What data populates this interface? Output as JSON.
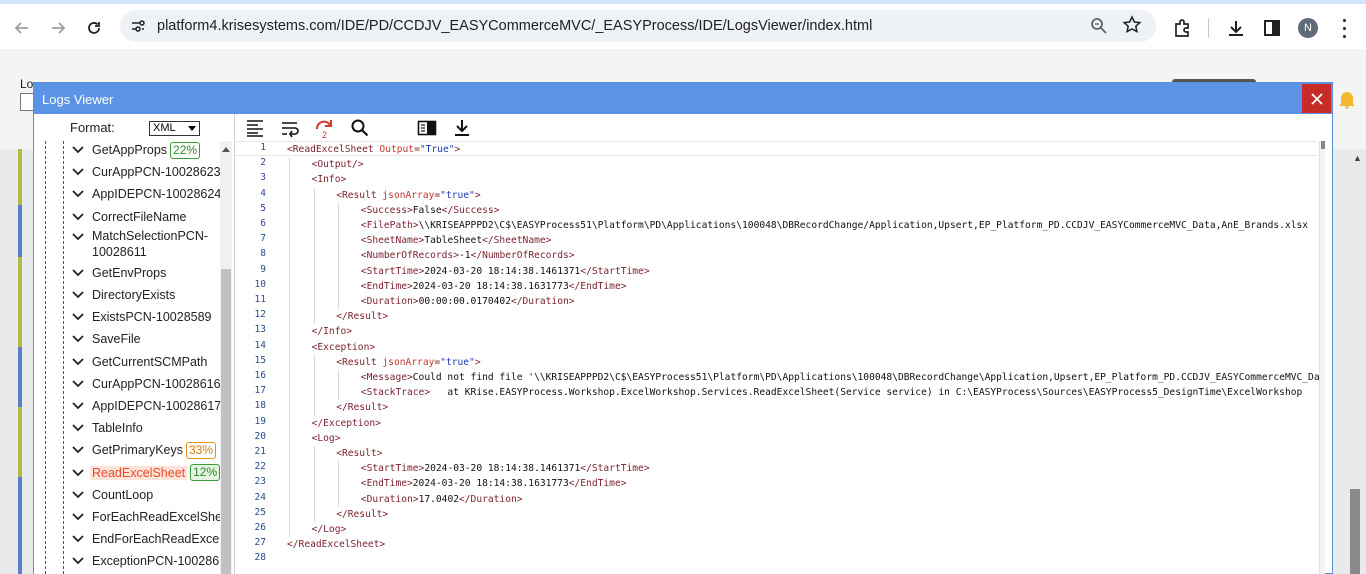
{
  "browser": {
    "url": "platform4.krisesystems.com/IDE/PD/CCDJV_EASYCommerceMVC/_EASYProcess/IDE/LogsViewer/index.html",
    "profile_initial": "N",
    "icons": [
      "back-icon",
      "forward-icon",
      "reload-icon",
      "site-settings-icon",
      "zoom-icon",
      "bookmark-star-icon",
      "extensions-icon",
      "download-icon",
      "side-panel-icon",
      "menu-icon"
    ]
  },
  "background": {
    "label_fragment": "Lo"
  },
  "modal": {
    "title": "Logs Viewer",
    "format_label": "Format:",
    "format_value": "XML"
  },
  "tree": {
    "items": [
      {
        "label": "GetAppProps",
        "badge": "22%",
        "badge_color": "green"
      },
      {
        "label": "CurAppPCN-10028623",
        "badge": ""
      },
      {
        "label": "AppIDEPCN-10028624",
        "badge": ""
      },
      {
        "label": "CorrectFileName",
        "badge": ""
      },
      {
        "label": "MatchSelectionPCN-10028611",
        "badge": ""
      },
      {
        "label": "GetEnvProps",
        "badge": ""
      },
      {
        "label": "DirectoryExists",
        "badge": ""
      },
      {
        "label": "ExistsPCN-10028589",
        "badge": ""
      },
      {
        "label": "SaveFile",
        "badge": ""
      },
      {
        "label": "GetCurrentSCMPath",
        "badge": ""
      },
      {
        "label": "CurAppPCN-10028616",
        "badge": ""
      },
      {
        "label": "AppIDEPCN-10028617",
        "badge": ""
      },
      {
        "label": "TableInfo",
        "badge": ""
      },
      {
        "label": "GetPrimaryKeys",
        "badge": "33%",
        "badge_color": "orange"
      },
      {
        "label": "ReadExcelSheet",
        "badge": "12%",
        "badge_color": "green",
        "selected": true
      },
      {
        "label": "CountLoop",
        "badge": ""
      },
      {
        "label": "ForEachReadExcelSheet",
        "badge": ""
      },
      {
        "label": "EndForEachReadExcelSheet",
        "badge": ""
      },
      {
        "label": "ExceptionPCN-10028610",
        "badge": ""
      }
    ]
  },
  "toolbar": {
    "tools": [
      "format-icon",
      "wrap-icon",
      "redo-icon",
      "search-icon",
      "panel-toggle-icon",
      "download-icon"
    ],
    "redo_count": "2"
  },
  "editor": {
    "lines": [
      {
        "n": "1",
        "indent": 0,
        "parts": [
          [
            "tag",
            "<ReadExcelSheet "
          ],
          [
            "attr",
            "Output"
          ],
          [
            "tag",
            "="
          ],
          [
            "val",
            "\"True\""
          ],
          [
            "tag",
            ">"
          ]
        ]
      },
      {
        "n": "2",
        "indent": 1,
        "parts": [
          [
            "tag",
            "<Output/>"
          ]
        ]
      },
      {
        "n": "3",
        "indent": 1,
        "parts": [
          [
            "tag",
            "<Info>"
          ]
        ]
      },
      {
        "n": "4",
        "indent": 2,
        "parts": [
          [
            "tag",
            "<Result "
          ],
          [
            "attr",
            "jsonArray"
          ],
          [
            "tag",
            "="
          ],
          [
            "val",
            "\"true\""
          ],
          [
            "tag",
            ">"
          ]
        ]
      },
      {
        "n": "5",
        "indent": 3,
        "parts": [
          [
            "tag",
            "<Success>"
          ],
          [
            "txt",
            "False"
          ],
          [
            "tag",
            "</Success>"
          ]
        ]
      },
      {
        "n": "6",
        "indent": 3,
        "parts": [
          [
            "tag",
            "<FilePath>"
          ],
          [
            "txt",
            "\\\\KRISEAPPPD2\\C$\\EASYProcess51\\Platform\\PD\\Applications\\100048\\DBRecordChange/Application,Upsert,EP_Platform_PD.CCDJV_EASYCommerceMVC_Data,AnE_Brands.xlsx"
          ]
        ]
      },
      {
        "n": "7",
        "indent": 3,
        "parts": [
          [
            "tag",
            "<SheetName>"
          ],
          [
            "txt",
            "TableSheet"
          ],
          [
            "tag",
            "</SheetName>"
          ]
        ]
      },
      {
        "n": "8",
        "indent": 3,
        "parts": [
          [
            "tag",
            "<NumberOfRecords>"
          ],
          [
            "txt",
            "-1"
          ],
          [
            "tag",
            "</NumberOfRecords>"
          ]
        ]
      },
      {
        "n": "9",
        "indent": 3,
        "parts": [
          [
            "tag",
            "<StartTime>"
          ],
          [
            "txt",
            "2024-03-20 18:14:38.1461371"
          ],
          [
            "tag",
            "</StartTime>"
          ]
        ]
      },
      {
        "n": "10",
        "indent": 3,
        "parts": [
          [
            "tag",
            "<EndTime>"
          ],
          [
            "txt",
            "2024-03-20 18:14:38.1631773"
          ],
          [
            "tag",
            "</EndTime>"
          ]
        ]
      },
      {
        "n": "11",
        "indent": 3,
        "parts": [
          [
            "tag",
            "<Duration>"
          ],
          [
            "txt",
            "00:00:00.0170402"
          ],
          [
            "tag",
            "</Duration>"
          ]
        ]
      },
      {
        "n": "12",
        "indent": 2,
        "parts": [
          [
            "tag",
            "</Result>"
          ]
        ]
      },
      {
        "n": "13",
        "indent": 1,
        "parts": [
          [
            "tag",
            "</Info>"
          ]
        ]
      },
      {
        "n": "14",
        "indent": 1,
        "parts": [
          [
            "tag",
            "<Exception>"
          ]
        ]
      },
      {
        "n": "15",
        "indent": 2,
        "parts": [
          [
            "tag",
            "<Result "
          ],
          [
            "attr",
            "jsonArray"
          ],
          [
            "tag",
            "="
          ],
          [
            "val",
            "\"true\""
          ],
          [
            "tag",
            ">"
          ]
        ]
      },
      {
        "n": "16",
        "indent": 3,
        "parts": [
          [
            "tag",
            "<Message>"
          ],
          [
            "txt",
            "Could not find file '\\\\KRISEAPPPD2\\C$\\EASYProcess51\\Platform\\PD\\Applications\\100048\\DBRecordChange\\Application,Upsert,EP_Platform_PD.CCDJV_EASYCommerceMVC_Data"
          ]
        ]
      },
      {
        "n": "17",
        "indent": 3,
        "parts": [
          [
            "tag",
            "<StackTrace>"
          ],
          [
            "txt",
            "   at KRise.EASYProcess.Workshop.ExcelWorkshop.Services.ReadExcelSheet(Service service) in C:\\EASYProcess\\Sources\\EASYProcess5_DesignTime\\ExcelWorkshop"
          ]
        ]
      },
      {
        "n": "18",
        "indent": 2,
        "parts": [
          [
            "tag",
            "</Result>"
          ]
        ]
      },
      {
        "n": "19",
        "indent": 1,
        "parts": [
          [
            "tag",
            "</Exception>"
          ]
        ]
      },
      {
        "n": "20",
        "indent": 1,
        "parts": [
          [
            "tag",
            "<Log>"
          ]
        ]
      },
      {
        "n": "21",
        "indent": 2,
        "parts": [
          [
            "tag",
            "<Result>"
          ]
        ]
      },
      {
        "n": "22",
        "indent": 3,
        "parts": [
          [
            "tag",
            "<StartTime>"
          ],
          [
            "txt",
            "2024-03-20 18:14:38.1461371"
          ],
          [
            "tag",
            "</StartTime>"
          ]
        ]
      },
      {
        "n": "23",
        "indent": 3,
        "parts": [
          [
            "tag",
            "<EndTime>"
          ],
          [
            "txt",
            "2024-03-20 18:14:38.1631773"
          ],
          [
            "tag",
            "</EndTime>"
          ]
        ]
      },
      {
        "n": "24",
        "indent": 3,
        "parts": [
          [
            "tag",
            "<Duration>"
          ],
          [
            "txt",
            "17.0402"
          ],
          [
            "tag",
            "</Duration>"
          ]
        ]
      },
      {
        "n": "25",
        "indent": 2,
        "parts": [
          [
            "tag",
            "</Result>"
          ]
        ]
      },
      {
        "n": "26",
        "indent": 1,
        "parts": [
          [
            "tag",
            "</Log>"
          ]
        ]
      },
      {
        "n": "27",
        "indent": 0,
        "parts": [
          [
            "tag",
            "</ReadExcelSheet>"
          ]
        ]
      },
      {
        "n": "28",
        "indent": 0,
        "parts": []
      }
    ]
  },
  "colors": {
    "modal_header": "#5b94e6",
    "close_button": "#c62b28",
    "xml_tag": "#7a1f2b",
    "xml_attr": "#c0392b",
    "xml_value": "#1a3bb8",
    "line_number": "#2a4d8c",
    "selected_node": "#e94a2e"
  }
}
